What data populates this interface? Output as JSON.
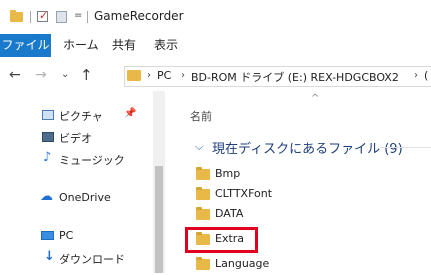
{
  "window": {
    "title": "GameRecorder",
    "quick_access_dropdown": "="
  },
  "ribbon": {
    "tabs": [
      {
        "label": "ファイル"
      },
      {
        "label": "ホーム"
      },
      {
        "label": "共有"
      },
      {
        "label": "表示"
      }
    ]
  },
  "address": {
    "crumbs": [
      "PC",
      "BD-ROM ドライブ (E:) REX-HDGCBOX2",
      "("
    ]
  },
  "nav_pane": {
    "items": [
      {
        "label": "ピクチャ",
        "icon": "pictures-icon"
      },
      {
        "label": "ビデオ",
        "icon": "videos-icon"
      },
      {
        "label": "ミュージック",
        "icon": "music-icon"
      },
      {
        "label": "OneDrive",
        "icon": "onedrive-icon"
      },
      {
        "label": "PC",
        "icon": "pc-icon"
      },
      {
        "label": "ダウンロード",
        "icon": "downloads-icon"
      }
    ]
  },
  "content": {
    "column_header": "名前",
    "group_title": "現在ディスクにあるファイル (9)",
    "files": [
      {
        "name": "Bmp"
      },
      {
        "name": "CLTTXFont"
      },
      {
        "name": "DATA"
      },
      {
        "name": "Extra"
      },
      {
        "name": "Language"
      }
    ],
    "highlighted_file": "Extra"
  },
  "colors": {
    "file_tab": "#1979ca",
    "folder": "#e8b946",
    "highlight": "#e1001e",
    "group_title": "#1e3f7a"
  }
}
